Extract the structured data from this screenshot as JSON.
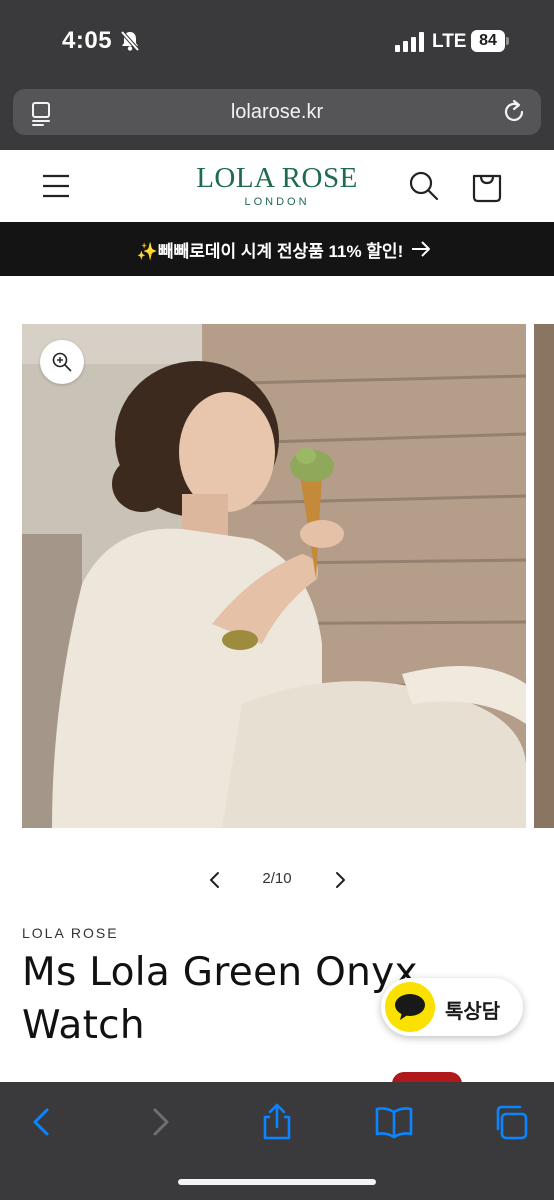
{
  "status_bar": {
    "time": "4:05",
    "network": "LTE",
    "battery": "84",
    "mute_icon": "bell-slash-icon",
    "signal_icon": "cellular-signal-icon"
  },
  "browser": {
    "url": "lolarose.kr",
    "reader_icon": "reader-mode-icon",
    "reload_icon": "reload-icon"
  },
  "header": {
    "logo_main": "LOLA ROSE",
    "logo_sub": "LONDON",
    "brand_color": "#1f6b4d"
  },
  "announcement": {
    "text": "✨빼빼로데이 시계 전상품 11% 할인!"
  },
  "gallery": {
    "counter": "2/10",
    "current": 2,
    "total": 10
  },
  "product": {
    "brand": "LOLA ROSE",
    "title": "Ms Lola Green Onyx Watch",
    "sale_color": "#b0191c"
  },
  "chat": {
    "label": "톡상담",
    "color": "#fae100"
  },
  "toolbar": {
    "icons": [
      "back-icon",
      "forward-icon",
      "share-icon",
      "bookmarks-icon",
      "tabs-icon"
    ],
    "accent": "#0a84ff"
  }
}
